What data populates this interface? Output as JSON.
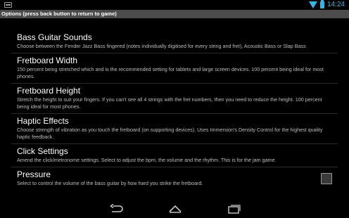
{
  "status_bar": {
    "time": "14:24",
    "icons": [
      "app-notification-icon",
      "wifi-icon",
      "battery-icon"
    ],
    "accent_color": "#33b5e5"
  },
  "title_bar": {
    "title": "Options (press back button to return to game)"
  },
  "preferences": [
    {
      "title": "Bass Guitar Sounds",
      "summary": "Choose between the Fender Jazz Bass fingered (notes individually digitised for every string and fret), Acoustic Bass or Slap Bass"
    },
    {
      "title": "Fretboard Width",
      "summary": "150 percent being stretched which and is the recommended setting for tablets and large screen devices. 100 percent being ideal for most phones."
    },
    {
      "title": "Fretboard Height",
      "summary": "Stretch the height to suit your fingers. If you can't see all 4 strings with the fret numbers, then you need to reduce the height. 100 percent being ideal for most phones."
    },
    {
      "title": "Haptic Effects",
      "summary": "Choose strength of vibration as you touch the fretboard (on supporting devices). Uses Immersion's Density Control for the highest quality haptic feedback."
    },
    {
      "title": "Click Settings",
      "summary": "Amend the click/metronome settings. Select to adjust the bpm, the volume and the rhythm. This is for the jam game."
    },
    {
      "title": "Pressure",
      "summary": "Select to control the volume of the bass guitar by how hard you strike the fretboard.",
      "checked": false
    }
  ],
  "nav_bar": {
    "icons": [
      "back-icon",
      "home-icon",
      "recents-icon"
    ]
  }
}
